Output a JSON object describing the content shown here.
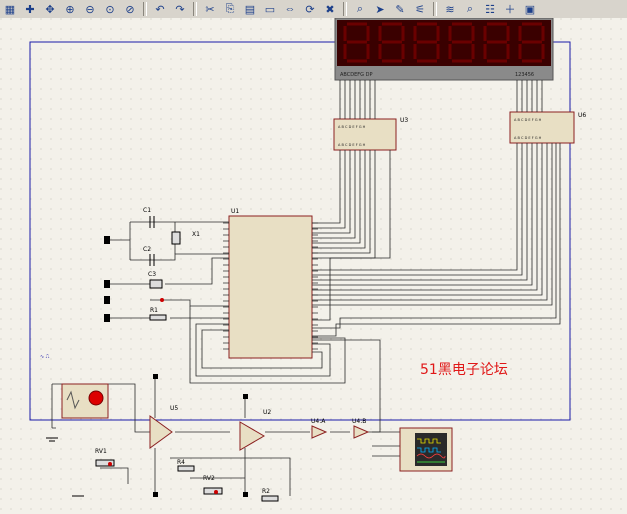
{
  "toolbar": {
    "items": [
      "grid-icon",
      "origin-icon",
      "pan-icon",
      "zoom-in-icon",
      "zoom-out-icon",
      "zoom-all-icon",
      "zoom-area-icon",
      "undo-icon",
      "redo-icon",
      "cut-icon",
      "copy-icon",
      "paste-icon",
      "block-copy-icon",
      "block-move-icon",
      "block-rotate-icon",
      "block-delete-icon",
      "pick-device-icon",
      "make-device-icon",
      "packaging-icon",
      "decompose-icon",
      "wire-autorouter-icon",
      "search-icon",
      "property-icon",
      "new-sheet-icon",
      "remove-sheet-icon"
    ]
  },
  "schematic": {
    "display_left_label": "ABCDEFG DP",
    "display_right_label": "123456",
    "ic_u3": "U3",
    "ic_u6": "U6",
    "ic_u1": "U1",
    "ic_u5": "U5",
    "ic_u2": "U2",
    "gate_a": "U4:A",
    "gate_b": "U4:B",
    "c1": "C1",
    "c2": "C2",
    "c3": "C3",
    "x1": "X1",
    "r1": "R1",
    "r2": "R2",
    "r4": "R4",
    "rv1": "RV1",
    "rv2": "RV2",
    "watermark": "51黑电子论坛"
  }
}
